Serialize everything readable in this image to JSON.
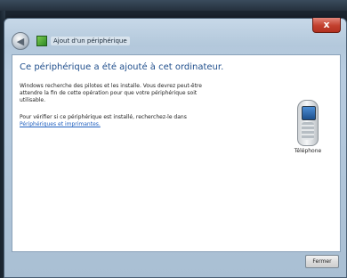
{
  "window": {
    "title": "Ajout d'un périphérique",
    "close_glyph": "x"
  },
  "content": {
    "heading": "Ce périphérique a été ajouté à cet ordinateur.",
    "paragraph1": "Windows recherche des pilotes et les installe. Vous devrez peut-être attendre la fin de cette opération pour que votre périphérique soit utilisable.",
    "paragraph2": "Pour vérifier si ce périphérique est installé, recherchez-le dans",
    "link_text": "Périphériques et imprimantes.",
    "device_label": "Téléphone"
  },
  "buttons": {
    "close_label": "Fermer"
  },
  "icons": [
    "back-arrow-icon",
    "device-wizard-icon",
    "phone-icon"
  ]
}
